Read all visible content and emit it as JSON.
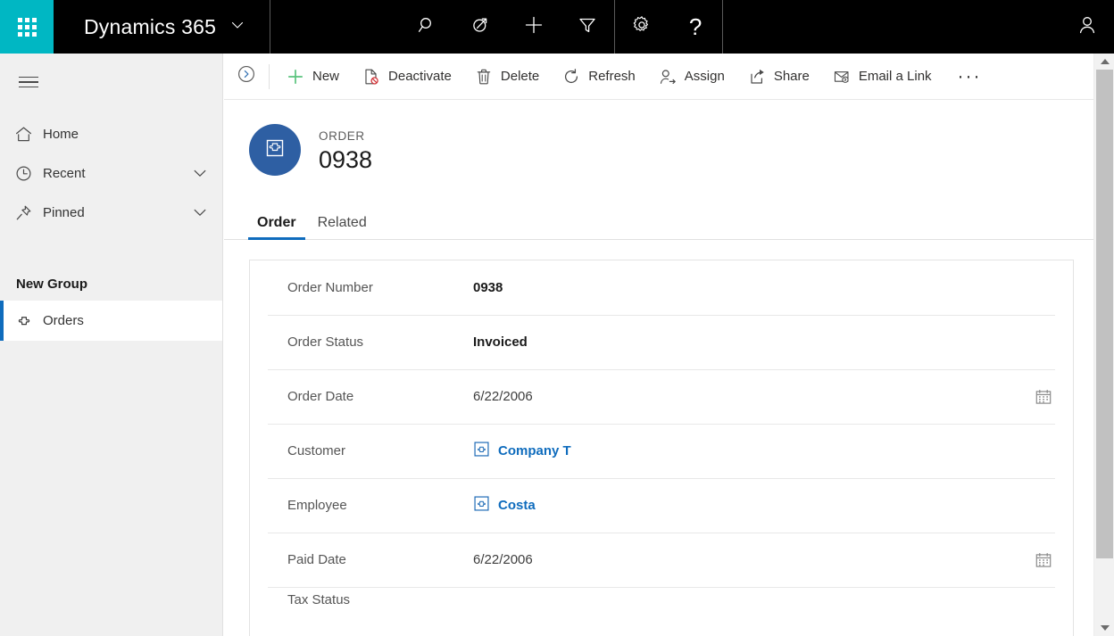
{
  "topnav": {
    "waffle_label": "app-launcher",
    "brand": "Dynamics 365",
    "chevron": "chevron-down-icon",
    "icons": [
      {
        "name": "search-icon",
        "label": "Search"
      },
      {
        "name": "assistant-icon",
        "label": "Assistant"
      },
      {
        "name": "quick-create-icon",
        "label": "Quick Create"
      },
      {
        "name": "filter-icon",
        "label": "Filter"
      }
    ],
    "right_icons": [
      {
        "name": "gear-icon",
        "label": "Settings"
      },
      {
        "name": "help-icon",
        "label": "Help"
      },
      {
        "name": "user-icon",
        "label": "Account"
      }
    ],
    "help_glyph": "?"
  },
  "sidebar": {
    "menu_label": "Site Map",
    "items": [
      {
        "label": "Home",
        "icon": "home-icon",
        "chevron": false
      },
      {
        "label": "Recent",
        "icon": "clock-icon",
        "chevron": true
      },
      {
        "label": "Pinned",
        "icon": "pin-icon",
        "chevron": true
      }
    ],
    "group_title": "New Group",
    "entity": {
      "label": "Orders",
      "icon": "entity-icon",
      "selected": true
    }
  },
  "commandbar": {
    "collapse_label": "Expand",
    "buttons": [
      {
        "label": "New",
        "icon": "plus-icon"
      },
      {
        "label": "Deactivate",
        "icon": "deactivate-icon"
      },
      {
        "label": "Delete",
        "icon": "trash-icon"
      },
      {
        "label": "Refresh",
        "icon": "refresh-icon"
      },
      {
        "label": "Assign",
        "icon": "assign-icon"
      },
      {
        "label": "Share",
        "icon": "share-icon"
      },
      {
        "label": "Email a Link",
        "icon": "email-link-icon"
      }
    ],
    "overflow": "···"
  },
  "record": {
    "entity_label": "ORDER",
    "title": "0938",
    "avatar_icon": "entity-icon"
  },
  "tabs": [
    {
      "label": "Order",
      "active": true
    },
    {
      "label": "Related",
      "active": false
    }
  ],
  "form": {
    "fields": [
      {
        "label": "Order Number",
        "value": "0938",
        "type": "strong"
      },
      {
        "label": "Order Status",
        "value": "Invoiced",
        "type": "strong"
      },
      {
        "label": "Order Date",
        "value": "6/22/2006",
        "type": "date"
      },
      {
        "label": "Customer",
        "value": "Company T",
        "type": "lookup"
      },
      {
        "label": "Employee",
        "value": "Costa",
        "type": "lookup"
      },
      {
        "label": "Paid Date",
        "value": "6/22/2006",
        "type": "date"
      },
      {
        "label": "Tax Status",
        "value": "",
        "type": "cut"
      }
    ]
  },
  "scrollbar": {
    "up": "scroll-up-arrow",
    "down": "scroll-down-arrow",
    "thumb": "scroll-thumb"
  },
  "colors": {
    "accent": "#0f6cbd",
    "waffle_bg": "#00b7c3",
    "topnav_bg": "#000000",
    "new_green": "#5ac37d",
    "avatar_blue": "#2e5fa3",
    "delete_red": "#d13438"
  }
}
